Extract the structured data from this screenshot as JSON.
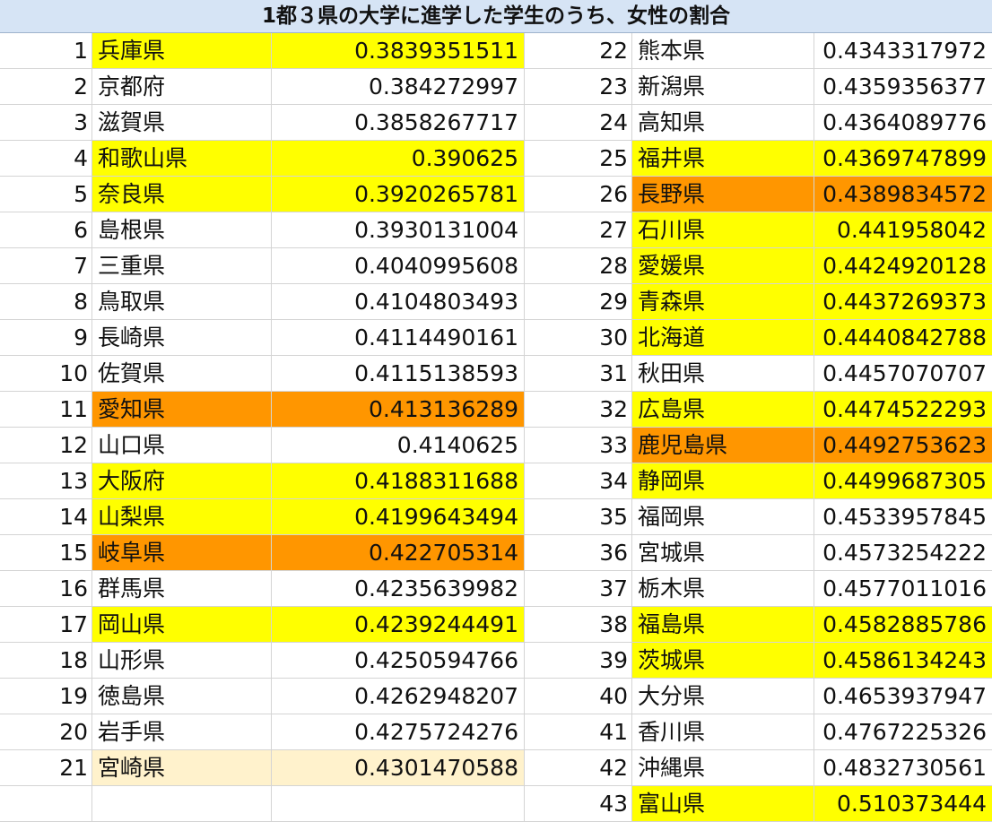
{
  "title": "1都３県の大学に進学した学生のうち、女性の割合",
  "colors": {
    "yellow": "#ffff00",
    "orange": "#ff9600",
    "cream": "#fff2cc",
    "header": "#d6e4f5"
  },
  "left": [
    {
      "rank": "1",
      "pref": "兵庫県",
      "value": "0.3839351511",
      "hl": "yellow"
    },
    {
      "rank": "2",
      "pref": "京都府",
      "value": "0.384272997",
      "hl": ""
    },
    {
      "rank": "3",
      "pref": "滋賀県",
      "value": "0.3858267717",
      "hl": ""
    },
    {
      "rank": "4",
      "pref": "和歌山県",
      "value": "0.390625",
      "hl": "yellow"
    },
    {
      "rank": "5",
      "pref": "奈良県",
      "value": "0.3920265781",
      "hl": "yellow"
    },
    {
      "rank": "6",
      "pref": "島根県",
      "value": "0.3930131004",
      "hl": ""
    },
    {
      "rank": "7",
      "pref": "三重県",
      "value": "0.4040995608",
      "hl": ""
    },
    {
      "rank": "8",
      "pref": "鳥取県",
      "value": "0.4104803493",
      "hl": ""
    },
    {
      "rank": "9",
      "pref": "長崎県",
      "value": "0.4114490161",
      "hl": ""
    },
    {
      "rank": "10",
      "pref": "佐賀県",
      "value": "0.4115138593",
      "hl": ""
    },
    {
      "rank": "11",
      "pref": "愛知県",
      "value": "0.413136289",
      "hl": "orange"
    },
    {
      "rank": "12",
      "pref": "山口県",
      "value": "0.4140625",
      "hl": ""
    },
    {
      "rank": "13",
      "pref": "大阪府",
      "value": "0.4188311688",
      "hl": "yellow"
    },
    {
      "rank": "14",
      "pref": "山梨県",
      "value": "0.4199643494",
      "hl": "yellow"
    },
    {
      "rank": "15",
      "pref": "岐阜県",
      "value": "0.422705314",
      "hl": "orange"
    },
    {
      "rank": "16",
      "pref": "群馬県",
      "value": "0.4235639982",
      "hl": ""
    },
    {
      "rank": "17",
      "pref": "岡山県",
      "value": "0.4239244491",
      "hl": "yellow"
    },
    {
      "rank": "18",
      "pref": "山形県",
      "value": "0.4250594766",
      "hl": ""
    },
    {
      "rank": "19",
      "pref": "徳島県",
      "value": "0.4262948207",
      "hl": ""
    },
    {
      "rank": "20",
      "pref": "岩手県",
      "value": "0.4275724276",
      "hl": ""
    },
    {
      "rank": "21",
      "pref": "宮崎県",
      "value": "0.4301470588",
      "hl": "cream"
    },
    {
      "rank": "",
      "pref": "",
      "value": "",
      "hl": ""
    }
  ],
  "right": [
    {
      "rank": "22",
      "pref": "熊本県",
      "value": "0.4343317972",
      "hl": ""
    },
    {
      "rank": "23",
      "pref": "新潟県",
      "value": "0.4359356377",
      "hl": ""
    },
    {
      "rank": "24",
      "pref": "高知県",
      "value": "0.4364089776",
      "hl": ""
    },
    {
      "rank": "25",
      "pref": "福井県",
      "value": "0.4369747899",
      "hl": "yellow"
    },
    {
      "rank": "26",
      "pref": "長野県",
      "value": "0.4389834572",
      "hl": "orange"
    },
    {
      "rank": "27",
      "pref": "石川県",
      "value": "0.441958042",
      "hl": "yellow"
    },
    {
      "rank": "28",
      "pref": "愛媛県",
      "value": "0.4424920128",
      "hl": "yellow"
    },
    {
      "rank": "29",
      "pref": "青森県",
      "value": "0.4437269373",
      "hl": "yellow"
    },
    {
      "rank": "30",
      "pref": "北海道",
      "value": "0.4440842788",
      "hl": "yellow"
    },
    {
      "rank": "31",
      "pref": "秋田県",
      "value": "0.4457070707",
      "hl": ""
    },
    {
      "rank": "32",
      "pref": "広島県",
      "value": "0.4474522293",
      "hl": "yellow"
    },
    {
      "rank": "33",
      "pref": "鹿児島県",
      "value": "0.4492753623",
      "hl": "orange"
    },
    {
      "rank": "34",
      "pref": "静岡県",
      "value": "0.4499687305",
      "hl": "yellow"
    },
    {
      "rank": "35",
      "pref": "福岡県",
      "value": "0.4533957845",
      "hl": ""
    },
    {
      "rank": "36",
      "pref": "宮城県",
      "value": "0.4573254222",
      "hl": ""
    },
    {
      "rank": "37",
      "pref": "栃木県",
      "value": "0.4577011016",
      "hl": ""
    },
    {
      "rank": "38",
      "pref": "福島県",
      "value": "0.4582885786",
      "hl": "yellow"
    },
    {
      "rank": "39",
      "pref": "茨城県",
      "value": "0.4586134243",
      "hl": "yellow"
    },
    {
      "rank": "40",
      "pref": "大分県",
      "value": "0.4653937947",
      "hl": ""
    },
    {
      "rank": "41",
      "pref": "香川県",
      "value": "0.4767225326",
      "hl": ""
    },
    {
      "rank": "42",
      "pref": "沖縄県",
      "value": "0.4832730561",
      "hl": ""
    },
    {
      "rank": "43",
      "pref": "富山県",
      "value": "0.510373444",
      "hl": "yellow"
    }
  ]
}
